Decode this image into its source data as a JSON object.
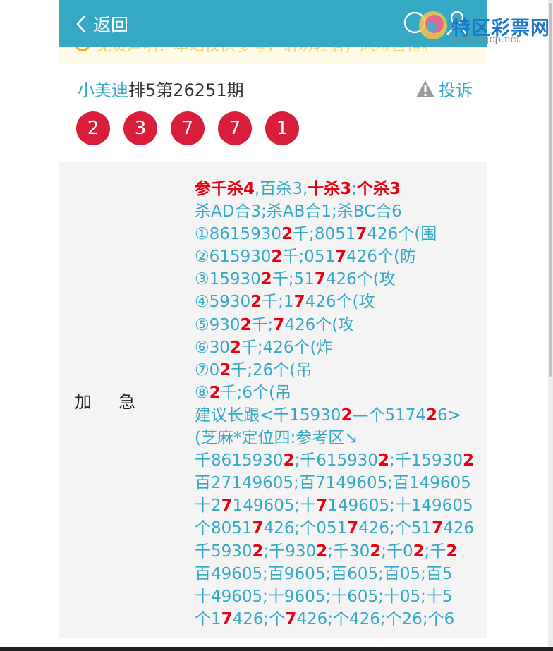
{
  "header": {
    "back_label": "返回",
    "logo_text": "特区彩票网",
    "logo_url": "www.tqcp.net",
    "bg_color": "#35a9c4"
  },
  "notice": {
    "text": "免责声明：本站仅供参考，请勿轻信，风险自担。",
    "icon": "warning-circle-icon"
  },
  "post": {
    "author": "小美迪",
    "issue": "排5第26251期",
    "complain_label": "投诉",
    "balls": [
      "2",
      "3",
      "7",
      "7",
      "1"
    ],
    "ball_color": "#d81e3a"
  },
  "content": {
    "label_1": "加",
    "label_2": "急",
    "lines": [
      [
        {
          "t": "参千杀4",
          "r": true
        },
        {
          "t": ",百杀3,",
          "r": false
        },
        {
          "t": "十杀3",
          "r": true
        },
        {
          "t": ";",
          "r": false
        },
        {
          "t": "个杀3",
          "r": true
        }
      ],
      [
        {
          "t": "杀AD合3;杀AB合1;杀BC合6",
          "r": false
        }
      ],
      [
        {
          "t": "①861593",
          "r": false
        },
        {
          "t": "0",
          "r": false
        },
        {
          "t": "2",
          "r": true
        },
        {
          "t": "千;8051",
          "r": false
        },
        {
          "t": "7",
          "r": true
        },
        {
          "t": "426个(围",
          "r": false
        }
      ],
      [
        {
          "t": "②615930",
          "r": false
        },
        {
          "t": "2",
          "r": true
        },
        {
          "t": "千;051",
          "r": false
        },
        {
          "t": "7",
          "r": true
        },
        {
          "t": "426个(防",
          "r": false
        }
      ],
      [
        {
          "t": "③15930",
          "r": false
        },
        {
          "t": "2",
          "r": true
        },
        {
          "t": "千;51",
          "r": false
        },
        {
          "t": "7",
          "r": true
        },
        {
          "t": "426个(攻",
          "r": false
        }
      ],
      [
        {
          "t": "④5930",
          "r": false
        },
        {
          "t": "2",
          "r": true
        },
        {
          "t": "千;1",
          "r": false
        },
        {
          "t": "7",
          "r": true
        },
        {
          "t": "426个(攻",
          "r": false
        }
      ],
      [
        {
          "t": "⑤930",
          "r": false
        },
        {
          "t": "2",
          "r": true
        },
        {
          "t": "千;",
          "r": false
        },
        {
          "t": "7",
          "r": true
        },
        {
          "t": "426个(攻",
          "r": false
        }
      ],
      [
        {
          "t": "⑥30",
          "r": false
        },
        {
          "t": "2",
          "r": true
        },
        {
          "t": "千;426个(炸",
          "r": false
        }
      ],
      [
        {
          "t": "⑦0",
          "r": false
        },
        {
          "t": "2",
          "r": true
        },
        {
          "t": "千;26个(吊",
          "r": false
        }
      ],
      [
        {
          "t": "⑧",
          "r": false
        },
        {
          "t": "2",
          "r": true
        },
        {
          "t": "千;6个(吊",
          "r": false
        }
      ],
      [
        {
          "t": "建议长跟<千15930",
          "r": false
        },
        {
          "t": "2",
          "r": true
        },
        {
          "t": "—个5174",
          "r": false
        },
        {
          "t": "2",
          "r": true
        },
        {
          "t": "6>",
          "r": false
        }
      ],
      [
        {
          "t": "(芝麻*定位四:参考区↘",
          "r": false
        }
      ],
      [
        {
          "t": "千8615930",
          "r": false
        },
        {
          "t": "2",
          "r": true
        },
        {
          "t": ";千615930",
          "r": false
        },
        {
          "t": "2",
          "r": true
        },
        {
          "t": ";千15930",
          "r": false
        },
        {
          "t": "2",
          "r": true
        }
      ],
      [
        {
          "t": "百27149605;百7149605;百149605",
          "r": false
        }
      ],
      [
        {
          "t": "十2",
          "r": false
        },
        {
          "t": "7",
          "r": true
        },
        {
          "t": "149605;十",
          "r": false
        },
        {
          "t": "7",
          "r": true
        },
        {
          "t": "149605;十149605",
          "r": false
        }
      ],
      [
        {
          "t": "个8051",
          "r": false
        },
        {
          "t": "7",
          "r": true
        },
        {
          "t": "426;个051",
          "r": false
        },
        {
          "t": "7",
          "r": true
        },
        {
          "t": "426;个51",
          "r": false
        },
        {
          "t": "7",
          "r": true
        },
        {
          "t": "426",
          "r": false
        }
      ],
      [
        {
          "t": "千5930",
          "r": false
        },
        {
          "t": "2",
          "r": true
        },
        {
          "t": ";千930",
          "r": false
        },
        {
          "t": "2",
          "r": true
        },
        {
          "t": ";千30",
          "r": false
        },
        {
          "t": "2",
          "r": true
        },
        {
          "t": ";千0",
          "r": false
        },
        {
          "t": "2",
          "r": true
        },
        {
          "t": ";千",
          "r": false
        },
        {
          "t": "2",
          "r": true
        }
      ],
      [
        {
          "t": "百49605;百9605;百605;百05;百5",
          "r": false
        }
      ],
      [
        {
          "t": "十49605;十9605;十605;十05;十5",
          "r": false
        }
      ],
      [
        {
          "t": "个1",
          "r": false
        },
        {
          "t": "7",
          "r": true
        },
        {
          "t": "426;个",
          "r": false
        },
        {
          "t": "7",
          "r": true
        },
        {
          "t": "426;个426;个26;个6",
          "r": false
        }
      ]
    ]
  }
}
